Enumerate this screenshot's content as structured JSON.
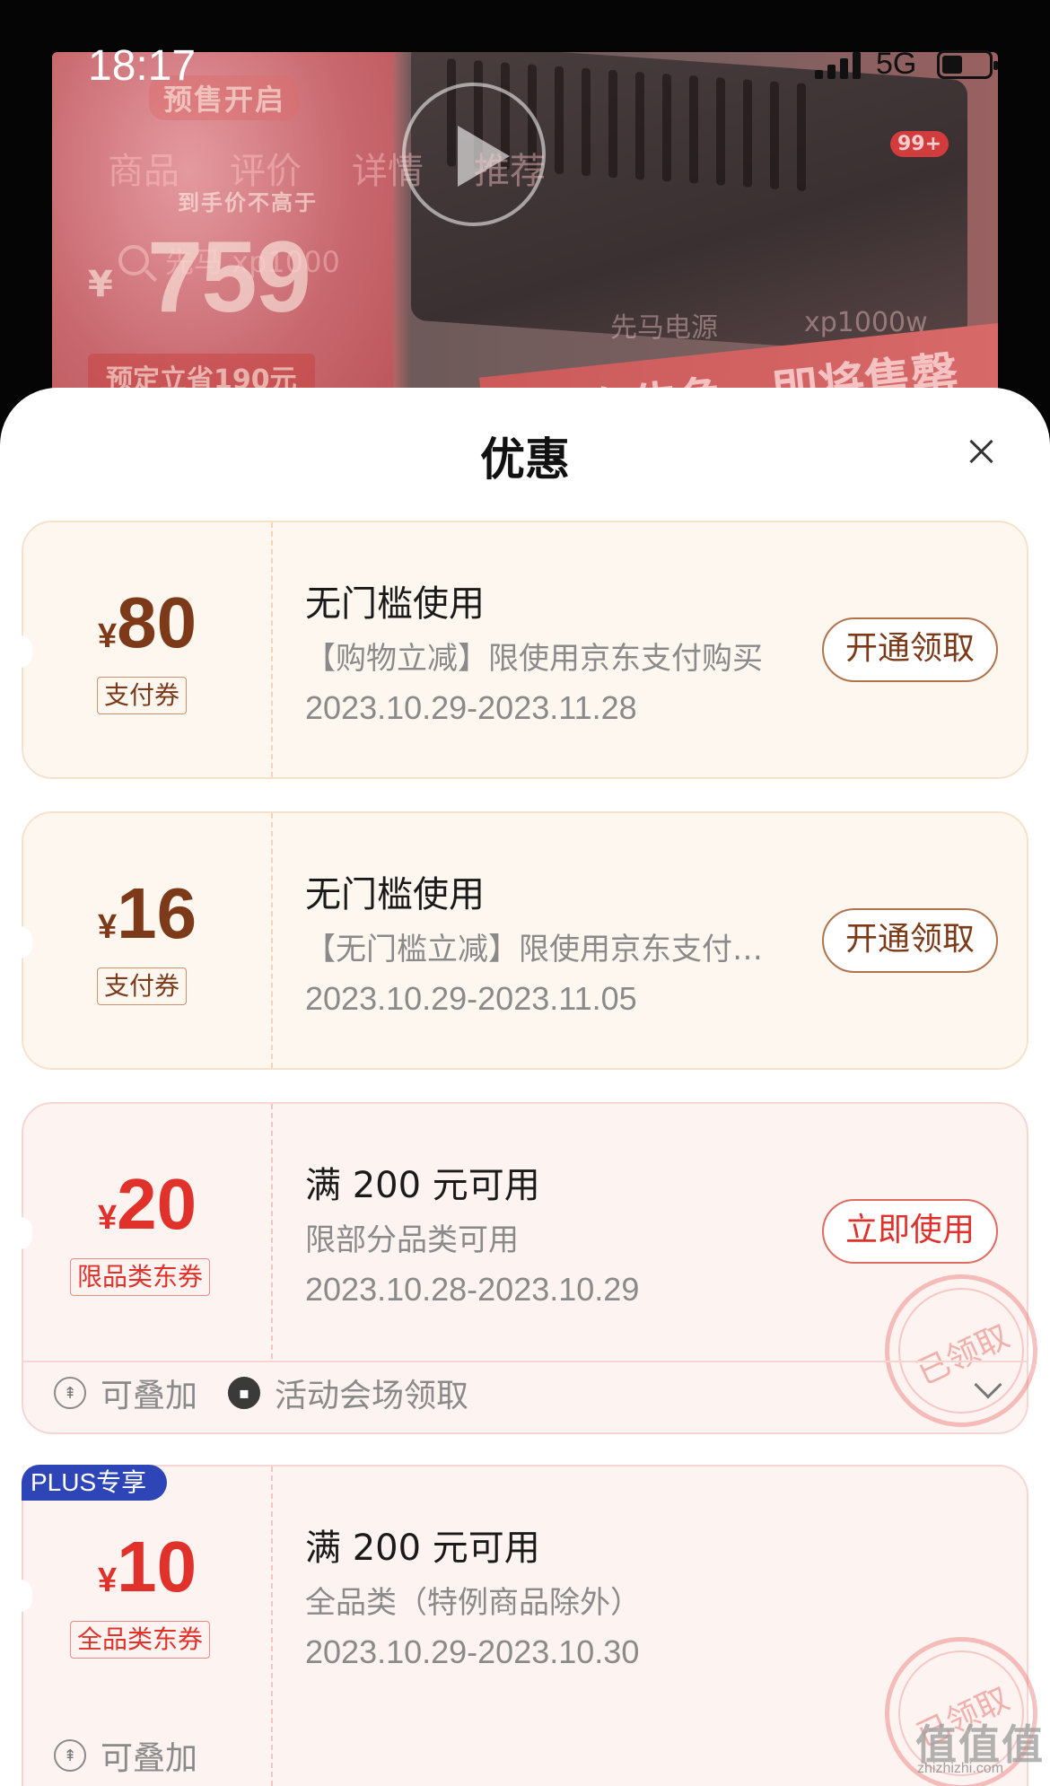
{
  "status_bar": {
    "time": "18:17",
    "network": "5G"
  },
  "background_page": {
    "promo": {
      "presale": "预售开启",
      "final_price_note": "到手价不高于",
      "yen": "¥",
      "price": "759",
      "deposit": "预定立省190元"
    },
    "tabs": [
      "商品",
      "评价",
      "详情",
      "推荐"
    ],
    "search_text": "先马 xp1000",
    "suggestion_1": "先马电源",
    "suggestion_2": "xp1000w",
    "cart_badge": "99+",
    "stock_banner": "库存告急，即将售罄"
  },
  "sheet": {
    "title": "优惠",
    "coupons": [
      {
        "style": "gold",
        "yen": "¥",
        "amount": "80",
        "tag": "支付券",
        "title": "无门槛使用",
        "desc": "【购物立减】限使用京东支付购买",
        "date": "2023.10.29-2023.11.28",
        "button": "开通领取"
      },
      {
        "style": "gold",
        "yen": "¥",
        "amount": "16",
        "tag": "支付券",
        "title": "无门槛使用",
        "desc": "【无门槛立减】限使用京东支付购买",
        "date": "2023.10.29-2023.11.05",
        "button": "开通领取"
      },
      {
        "style": "red",
        "yen": "¥",
        "amount": "20",
        "tag": "限品类东券",
        "title": "满 200 元可用",
        "desc": "限部分品类可用",
        "date": "2023.10.28-2023.10.29",
        "button": "立即使用",
        "stamp": "已领取",
        "footer": {
          "stackable": "可叠加",
          "source": "活动会场领取"
        }
      },
      {
        "style": "red",
        "badge": "PLUS专享",
        "yen": "¥",
        "amount": "10",
        "tag": "全品类东券",
        "title": "满 200 元可用",
        "desc": "全品类（特例商品除外）",
        "date": "2023.10.29-2023.10.30",
        "stamp": "已领取",
        "footer": {
          "stackable": "可叠加"
        }
      }
    ]
  },
  "watermark": {
    "text": "值值值",
    "sub": "zhizhizhi.com"
  },
  "colors": {
    "gold_text": "#7c3a19",
    "red_text": "#e0312a",
    "plus_badge": "#2e45b8"
  }
}
